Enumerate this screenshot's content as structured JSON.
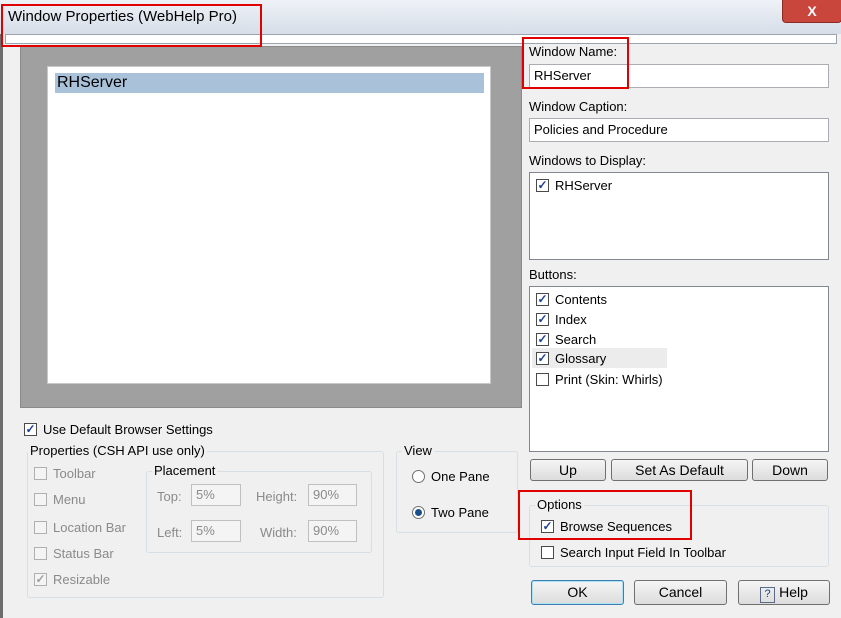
{
  "window": {
    "title": "Window Properties (WebHelp Pro)",
    "close_glyph": "X"
  },
  "preview": {
    "selected_item": "RHServer"
  },
  "window_name": {
    "label": "Window Name:",
    "value": "RHServer"
  },
  "window_caption": {
    "label": "Window Caption:",
    "value": "Policies and Procedure"
  },
  "windows_to_display": {
    "label": "Windows to Display:",
    "items": [
      {
        "label": "RHServer",
        "checked": true
      }
    ]
  },
  "buttons_list": {
    "label": "Buttons:",
    "items": [
      {
        "label": "Contents",
        "checked": true
      },
      {
        "label": "Index",
        "checked": true
      },
      {
        "label": "Search",
        "checked": true
      },
      {
        "label": "Glossary",
        "checked": true
      },
      {
        "label": "Print (Skin: Whirls)",
        "checked": false
      }
    ]
  },
  "list_actions": {
    "up": "Up",
    "set_default": "Set As Default",
    "down": "Down"
  },
  "options": {
    "title": "Options",
    "browse_sequences": "Browse Sequences",
    "search_input": "Search Input Field In Toolbar"
  },
  "browser": {
    "use_default": "Use Default Browser Settings"
  },
  "properties": {
    "title": "Properties (CSH API use only)",
    "toolbar": "Toolbar",
    "menu": "Menu",
    "location_bar": "Location Bar",
    "status_bar": "Status Bar",
    "resizable": "Resizable"
  },
  "placement": {
    "title": "Placement",
    "top_label": "Top:",
    "top_value": "5%",
    "height_label": "Height:",
    "height_value": "90%",
    "left_label": "Left:",
    "left_value": "5%",
    "width_label": "Width:",
    "width_value": "90%"
  },
  "view": {
    "title": "View",
    "one_pane": "One Pane",
    "two_pane": "Two Pane"
  },
  "footer": {
    "ok": "OK",
    "cancel": "Cancel",
    "help": "Help",
    "help_glyph": "?"
  },
  "colors": {
    "highlight_box": "#e00000",
    "selection": "#a9c1d9"
  }
}
